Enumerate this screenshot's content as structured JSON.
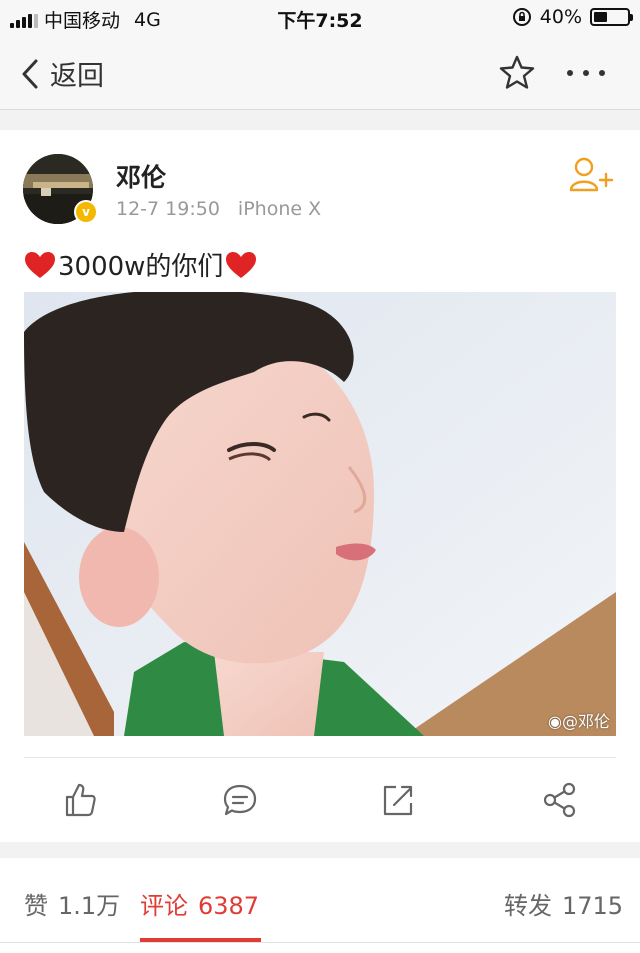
{
  "status_bar": {
    "carrier": "中国移动",
    "network": "4G",
    "time": "下午7:52",
    "battery": "40%",
    "battery_level": 0.4
  },
  "nav": {
    "back_label": "返回"
  },
  "post": {
    "author": "邓伦",
    "time": "12-7 19:50",
    "device": "iPhone X",
    "text": "3000w的你们",
    "watermark": "@邓伦"
  },
  "tabs": {
    "like_label": "赞",
    "like_count": "1.1万",
    "comment_label": "评论",
    "comment_count": "6387",
    "repost_label": "转发",
    "repost_count": "1715"
  },
  "colors": {
    "accent_red": "#e03c36",
    "follow_orange": "#f0a020",
    "verified_gold": "#f5b800"
  }
}
